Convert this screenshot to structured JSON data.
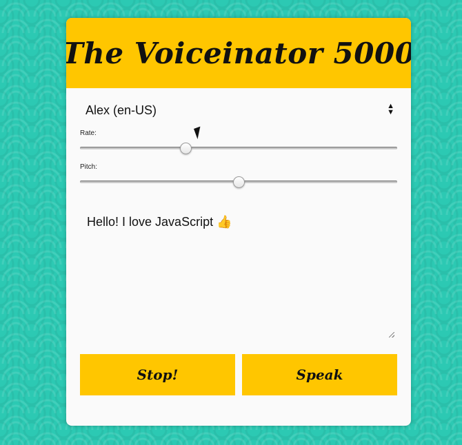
{
  "app": {
    "title": "The Voiceinator 5000"
  },
  "voice_select": {
    "selected": "Alex (en-US)",
    "arrow_up": "▲",
    "arrow_down": "▼"
  },
  "rate": {
    "label": "Rate:",
    "value": 1,
    "min": 0,
    "max": 3
  },
  "pitch": {
    "label": "Pitch:",
    "value": 1,
    "min": 0,
    "max": 2
  },
  "message": {
    "text": "Hello! I love JavaScript 👍"
  },
  "buttons": {
    "stop": "Stop!",
    "speak": "Speak"
  },
  "colors": {
    "background": "#2cc9b3",
    "accent": "#ffc600",
    "panel": "#fafafa"
  }
}
